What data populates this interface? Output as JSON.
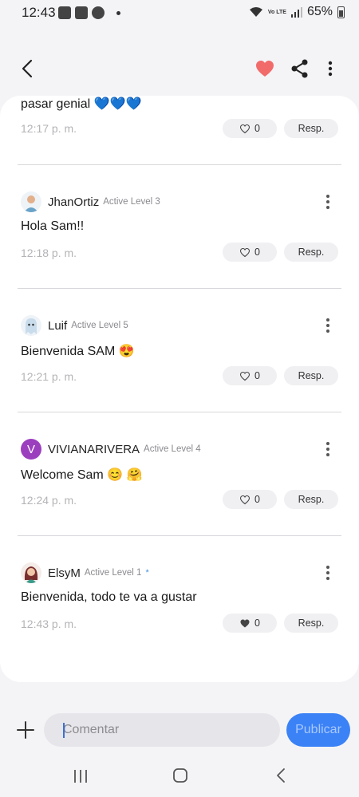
{
  "status_bar": {
    "time": "12:43",
    "battery": "65%",
    "volte": "Vo LTE"
  },
  "colors": {
    "accent": "#3b82f6",
    "heart": "#f26b6b",
    "card": "#ffffff",
    "background": "#f4f4f7"
  },
  "top_partial_comment": {
    "text": "pasar genial 💙💙💙",
    "time": "12:17 p. m.",
    "likes": "0",
    "reply_label": "Resp."
  },
  "comments": [
    {
      "username": "JhanOrtiz",
      "level": "Active Level 3",
      "avatar_icon": "person-avatar-icon",
      "text": "Hola Sam!!",
      "time": "12:18 p. m.",
      "likes": "0",
      "liked": false,
      "reply_label": "Resp."
    },
    {
      "username": "Luif",
      "level": "Active Level 5",
      "avatar_icon": "ghost-avatar-icon",
      "text": "Bienvenida SAM 😍",
      "time": "12:21 p. m.",
      "likes": "0",
      "liked": false,
      "reply_label": "Resp."
    },
    {
      "username": "VIVIANARIVERA",
      "level": "Active Level 4",
      "avatar_letter": "V",
      "text": "Welcome Sam 😊 🤗",
      "time": "12:24 p. m.",
      "likes": "0",
      "liked": false,
      "reply_label": "Resp."
    },
    {
      "username": "ElsyM",
      "level": "Active Level 1",
      "avatar_icon": "woman-avatar-icon",
      "badge": "*",
      "text": "Bienvenida, todo te va a gustar",
      "time": "12:43 p. m.",
      "likes": "0",
      "liked": true,
      "reply_label": "Resp."
    }
  ],
  "composer": {
    "placeholder": "Comentar",
    "publish_label": "Publicar"
  }
}
